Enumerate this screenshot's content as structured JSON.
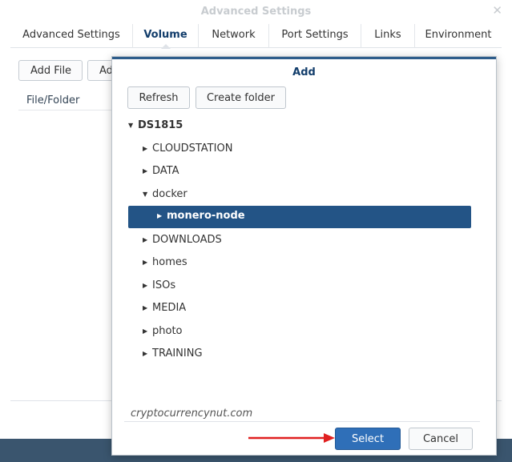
{
  "background_window": {
    "title": "Advanced Settings",
    "close_icon": "close-icon",
    "tabs": [
      {
        "label": "Advanced Settings",
        "active": false
      },
      {
        "label": "Volume",
        "active": true
      },
      {
        "label": "Network",
        "active": false
      },
      {
        "label": "Port Settings",
        "active": false
      },
      {
        "label": "Links",
        "active": false
      },
      {
        "label": "Environment",
        "active": false
      }
    ],
    "toolbar": {
      "add_file": "Add File",
      "add_folder_partial": "Ad"
    },
    "table": {
      "column_file_folder": "File/Folder"
    }
  },
  "dialog": {
    "title": "Add",
    "refresh_label": "Refresh",
    "create_folder_label": "Create folder",
    "tree": {
      "root": "DS1815",
      "items": [
        {
          "label": "CLOUDSTATION",
          "expanded": false
        },
        {
          "label": "DATA",
          "expanded": false
        },
        {
          "label": "docker",
          "expanded": true
        },
        {
          "label": "monero-node",
          "selected": true,
          "level": 2
        },
        {
          "label": "DOWNLOADS",
          "expanded": false
        },
        {
          "label": "homes",
          "expanded": false
        },
        {
          "label": "ISOs",
          "expanded": false
        },
        {
          "label": "MEDIA",
          "expanded": false
        },
        {
          "label": "photo",
          "expanded": false
        },
        {
          "label": "TRAINING",
          "expanded": false
        }
      ]
    },
    "watermark": "cryptocurrencynut.com",
    "select_label": "Select",
    "cancel_label": "Cancel"
  },
  "colors": {
    "accent": "#2f6fb8",
    "selected_row": "#235486",
    "title_text": "#123d6b",
    "annotation_arrow": "#e02020"
  }
}
